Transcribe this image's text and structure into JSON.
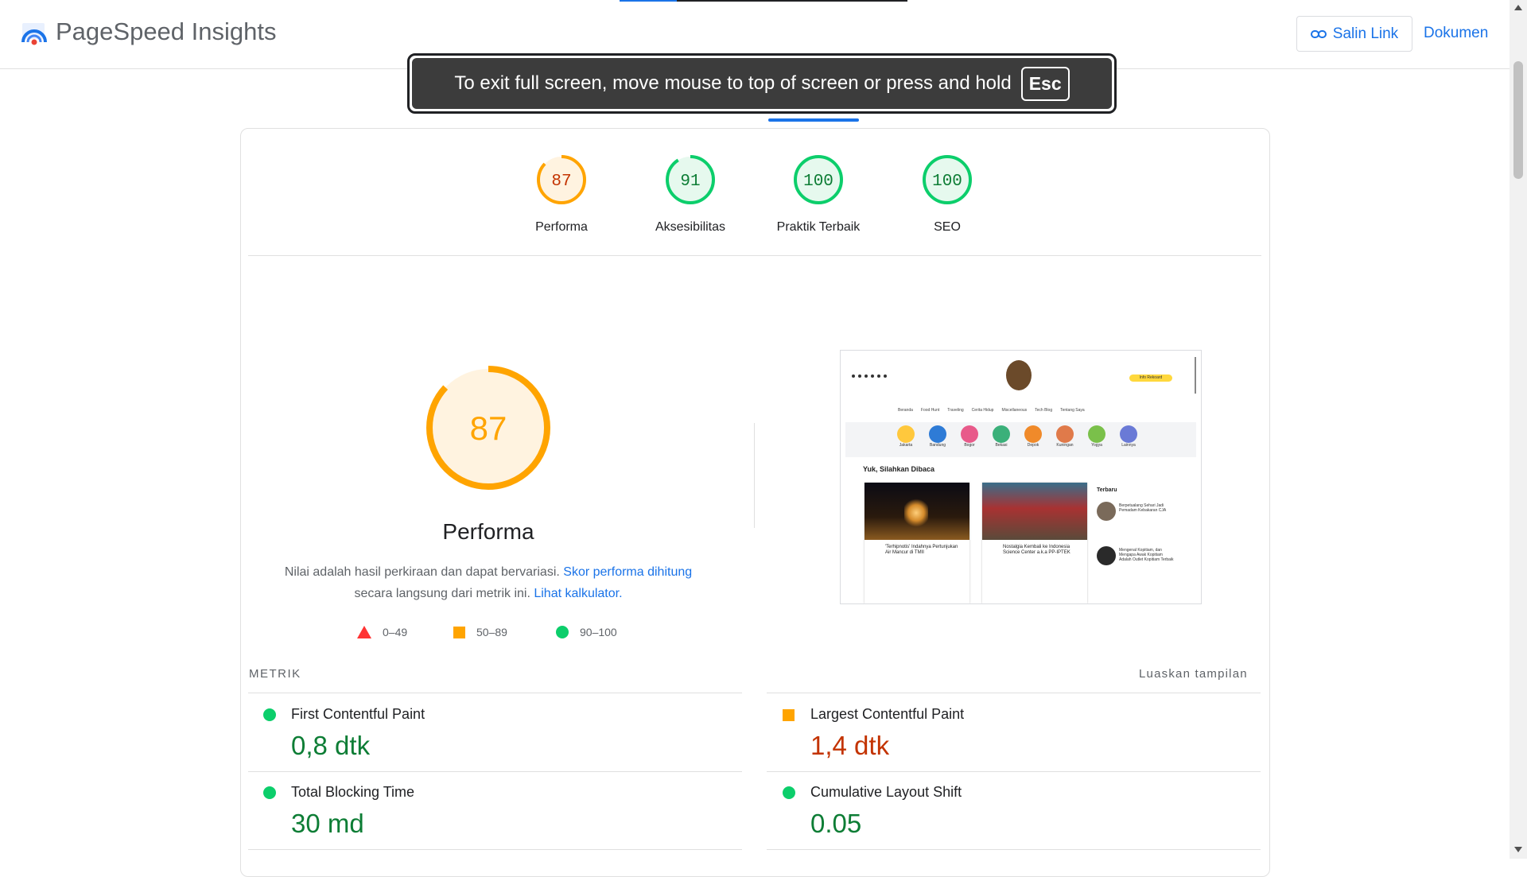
{
  "header": {
    "app_title": "PageSpeed Insights",
    "copy_link_label": "Salin Link",
    "docs_label": "Dokumen"
  },
  "fullscreen_toast": {
    "message": "To exit full screen, move mouse to top of screen or press and hold",
    "key": "Esc"
  },
  "scores": [
    {
      "label": "Performa",
      "value": "87",
      "score": 87,
      "color": "#ffa400",
      "text_color": "#c33300",
      "bg": "#fff3e0"
    },
    {
      "label": "Aksesibilitas",
      "value": "91",
      "score": 91,
      "color": "#0cce6b",
      "text_color": "#0d7d35",
      "bg": "#e6f9ee"
    },
    {
      "label": "Praktik Terbaik",
      "value": "100",
      "score": 100,
      "color": "#0cce6b",
      "text_color": "#0d7d35",
      "bg": "#e6f9ee"
    },
    {
      "label": "SEO",
      "value": "100",
      "score": 100,
      "color": "#0cce6b",
      "text_color": "#0d7d35",
      "bg": "#e6f9ee"
    }
  ],
  "performance": {
    "score": "87",
    "title": "Performa",
    "desc_1": "Nilai adalah hasil perkiraan dan dapat bervariasi.",
    "desc_link_1": "Skor performa dihitung",
    "desc_2": "secara langsung dari metrik ini.",
    "desc_link_2": "Lihat kalkulator."
  },
  "legend": [
    {
      "range": "0–49"
    },
    {
      "range": "50–89"
    },
    {
      "range": "90–100"
    }
  ],
  "metrics": {
    "heading": "METRIK",
    "expand_label": "Luaskan tampilan",
    "items": [
      {
        "label": "First Contentful Paint",
        "value": "0,8 dtk",
        "status": "pass"
      },
      {
        "label": "Largest Contentful Paint",
        "value": "1,4 dtk",
        "status": "average"
      },
      {
        "label": "Total Blocking Time",
        "value": "30 md",
        "status": "pass"
      },
      {
        "label": "Cumulative Layout Shift",
        "value": "0.05",
        "status": "pass"
      }
    ]
  },
  "thumbnail": {
    "nav_items": [
      "Beranda",
      "Food Hunt",
      "Traveling",
      "Cerita Hidup",
      "Miscellaneous",
      "Tech Blog",
      "Tentang Saya"
    ],
    "cities": [
      "Jakarta",
      "Bandung",
      "Bogor",
      "Bekasi",
      "Depok",
      "Kuningan",
      "Yogya",
      "Lainnya"
    ],
    "section_title": "Yuk, Silahkan Dibaca",
    "card1_title": "'Terhipnotis' Indahnya Pertunjukan Air Mancur di TMII",
    "card2_title": "Nostalgia Kembali ke Indonesia Science Center a.k.a PP-IPTEK",
    "sidebar_title": "Terbaru",
    "side1": "Berpetualang Sehari Jadi Pemadam Kebakaran CJA",
    "side2": "Mengenal Kopitiam, dan Mengapa Awak Kopitiam Adalah Outlet Kopitiam Terbaik",
    "badge": "Info Rekoard"
  }
}
